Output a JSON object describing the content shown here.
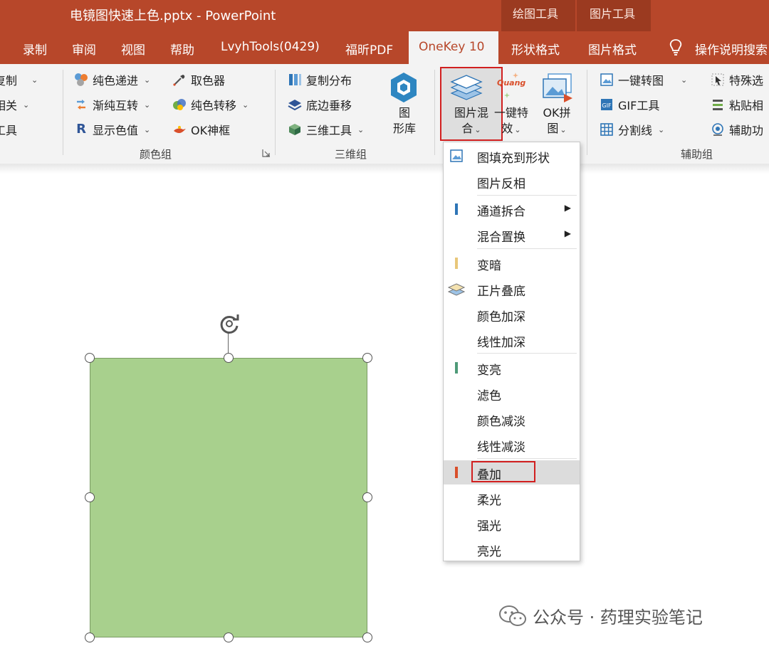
{
  "window": {
    "title": "电镜图快速上色.pptx  -  PowerPoint"
  },
  "context_groups": [
    {
      "label": "绘图工具"
    },
    {
      "label": "图片工具"
    }
  ],
  "tabs": [
    {
      "label": "录制"
    },
    {
      "label": "审阅"
    },
    {
      "label": "视图"
    },
    {
      "label": "帮助"
    },
    {
      "label": "LvyhTools(0429)"
    },
    {
      "label": "福昕PDF"
    },
    {
      "label": "OneKey 10",
      "active": true
    },
    {
      "label": "形状格式"
    },
    {
      "label": "图片格式"
    },
    {
      "label": "操作说明搜索"
    }
  ],
  "ribbon": {
    "left_partial": [
      "复制",
      "相关",
      "工具"
    ],
    "color_group": {
      "label": "颜色组",
      "items": [
        "纯色递进",
        "取色器",
        "渐纯互转",
        "纯色转移",
        "显示色值",
        "OK神框"
      ]
    },
    "three_d_group": {
      "label": "三维组",
      "items": [
        "复制分布",
        "底边垂移",
        "三维工具"
      ],
      "big_button": [
        "图",
        "形库"
      ]
    },
    "blend_group": {
      "picture_blend": [
        "图片混",
        "合"
      ],
      "one_key_fx": [
        "一键特",
        "效"
      ],
      "ok_stitch": [
        "OK拼",
        "图"
      ],
      "quang_badge": "Quang"
    },
    "aux_group": {
      "label": "辅助组",
      "items": [
        "一键转图",
        "特殊选",
        "GIF工具",
        "粘贴相",
        "分割线",
        "辅助功"
      ]
    }
  },
  "menu": {
    "items": [
      {
        "label": "图填充到形状"
      },
      {
        "label": "图片反相"
      },
      {
        "label": "通道拆合",
        "submenu": true
      },
      {
        "label": "混合置换",
        "submenu": true
      },
      {
        "label": "变暗"
      },
      {
        "label": "正片叠底"
      },
      {
        "label": "颜色加深"
      },
      {
        "label": "线性加深"
      },
      {
        "label": "变亮"
      },
      {
        "label": "滤色"
      },
      {
        "label": "颜色减淡"
      },
      {
        "label": "线性减淡"
      },
      {
        "label": "叠加",
        "selected": true
      },
      {
        "label": "柔光"
      },
      {
        "label": "强光"
      },
      {
        "label": "亮光"
      }
    ]
  },
  "colors": {
    "accent": "#b7472a",
    "shape_fill": "#a8d08d",
    "highlight_box": "#d11f1f"
  },
  "watermark": {
    "text": "公众号 · 药理实验笔记"
  }
}
